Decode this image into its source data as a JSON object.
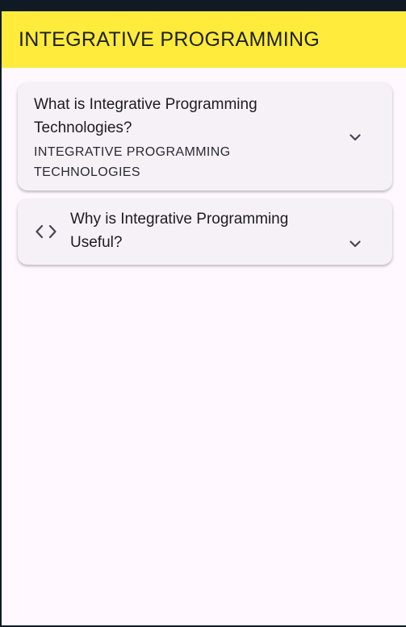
{
  "app_bar": {
    "title": "INTEGRATIVE PROGRAMMING"
  },
  "cards": [
    {
      "title": "What is Integrative Programming Technologies?",
      "subtitle": "INTEGRATIVE PROGRAMMING TECHNOLOGIES",
      "expanded": false,
      "trailing_icon": "chevron-down-icon"
    },
    {
      "title": "Why is Integrative Programming Useful?",
      "leading_icon": "code-icon",
      "expanded": false,
      "trailing_icon": "chevron-down-icon"
    }
  ],
  "colors": {
    "app_bar_bg": "#ffeb3b",
    "page_bg": "#fff8fe",
    "card_bg": "#f6f1f7",
    "text": "#1d1b20"
  }
}
